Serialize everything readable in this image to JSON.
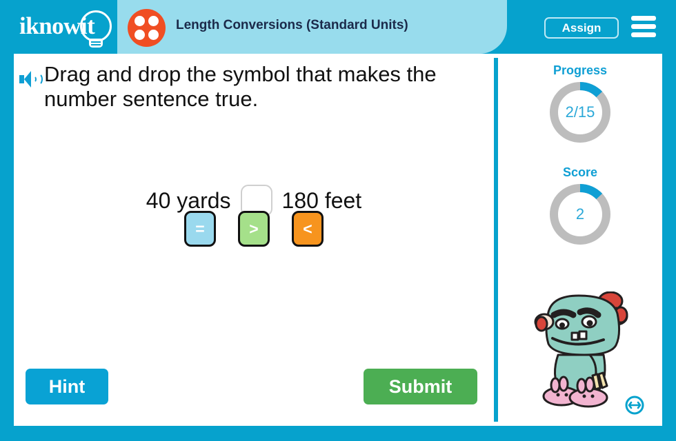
{
  "header": {
    "logo_text": "iknowit",
    "logo_icon": "lightbulb-icon",
    "dots_icon": "four-dots-icon",
    "title": "Length Conversions (Standard Units)",
    "assign_label": "Assign",
    "menu_icon": "hamburger-menu-icon"
  },
  "question": {
    "speaker_icon": "speaker-audio-icon",
    "text": "Drag and drop the symbol that makes the number sentence true."
  },
  "sentence": {
    "left_term": "40 yards",
    "right_term": "180 feet",
    "dropzone_value": ""
  },
  "tiles": [
    {
      "symbol": "=",
      "name": "equals",
      "color": "#9ad9ee"
    },
    {
      "symbol": ">",
      "name": "greater-than",
      "color": "#a5e08a"
    },
    {
      "symbol": "<",
      "name": "less-than",
      "color": "#f7941e"
    }
  ],
  "actions": {
    "hint_label": "Hint",
    "submit_label": "Submit"
  },
  "panel": {
    "progress": {
      "label": "Progress",
      "value": "2/15",
      "current": 2,
      "total": 15,
      "percent": 13
    },
    "score": {
      "label": "Score",
      "value": "2",
      "percent": 13
    },
    "mascot_name": "monster-mascot",
    "resize_icon": "resize-horizontal-icon"
  },
  "colors": {
    "brand_cyan": "#06a2cd",
    "title_band": "#98dced",
    "accent_orange": "#f04e23",
    "submit_green": "#4cae53",
    "ring_track": "#bdbdbd",
    "ring_fill": "#0f9fd4"
  }
}
